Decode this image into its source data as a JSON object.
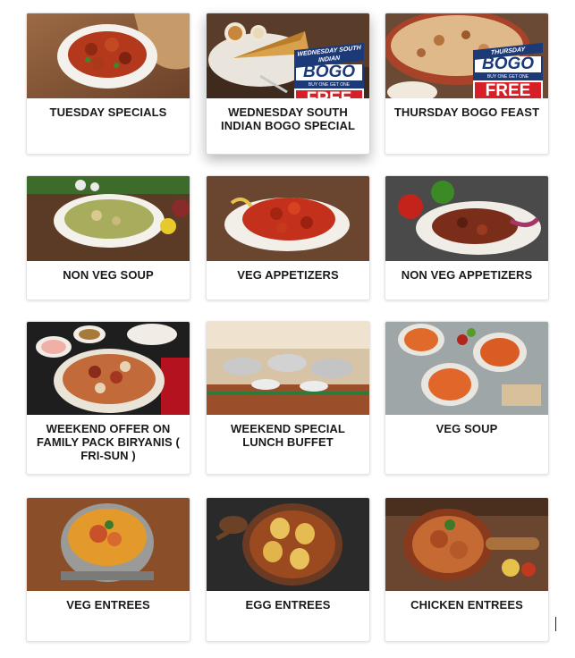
{
  "cards": [
    {
      "label": "TUESDAY SPECIALS"
    },
    {
      "label": "WEDNESDAY SOUTH INDIAN BOGO SPECIAL",
      "badge": {
        "top": "WEDNESDAY SOUTH INDIAN",
        "main": "BOGO",
        "sub": "BUY ONE GET ONE",
        "free": "FREE"
      }
    },
    {
      "label": "THURSDAY BOGO FEAST",
      "badge": {
        "top": "THURSDAY",
        "main": "BOGO",
        "sub": "BUY ONE GET ONE",
        "free": "FREE"
      }
    },
    {
      "label": "NON VEG SOUP"
    },
    {
      "label": "VEG APPETIZERS"
    },
    {
      "label": "NON VEG APPETIZERS"
    },
    {
      "label": "WEEKEND OFFER ON FAMILY PACK BIRYANIS ( FRI-SUN )"
    },
    {
      "label": "WEEKEND SPECIAL LUNCH BUFFET"
    },
    {
      "label": "VEG SOUP"
    },
    {
      "label": "VEG ENTREES"
    },
    {
      "label": "EGG ENTREES"
    },
    {
      "label": "CHICKEN ENTREES"
    }
  ]
}
